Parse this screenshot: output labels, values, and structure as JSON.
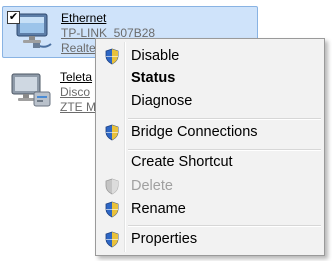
{
  "adapters": [
    {
      "name": "Ethernet",
      "network": "TP-LINK_507B28",
      "device": "Realtek",
      "checked_mark": "✔",
      "icon": "network-adapter-icon"
    },
    {
      "name": "Teleta",
      "network": "Disco",
      "device": "ZTE M",
      "icon": "modem-adapter-icon"
    }
  ],
  "context_menu": {
    "items": [
      {
        "label": "Disable",
        "icon": "uac-shield-icon"
      },
      {
        "label": "Status"
      },
      {
        "label": "Diagnose"
      },
      {
        "label": "Bridge Connections",
        "icon": "uac-shield-icon"
      },
      {
        "label": "Create Shortcut"
      },
      {
        "label": "Delete",
        "icon": "uac-shield-icon"
      },
      {
        "label": "Rename",
        "icon": "uac-shield-icon"
      },
      {
        "label": "Properties",
        "icon": "uac-shield-icon"
      }
    ]
  },
  "colors": {
    "selection_bg": "#cfe3fa",
    "selection_border": "#89b3e3",
    "menu_bg": "#f2f2f2",
    "disabled_text": "#a0a0a0"
  }
}
